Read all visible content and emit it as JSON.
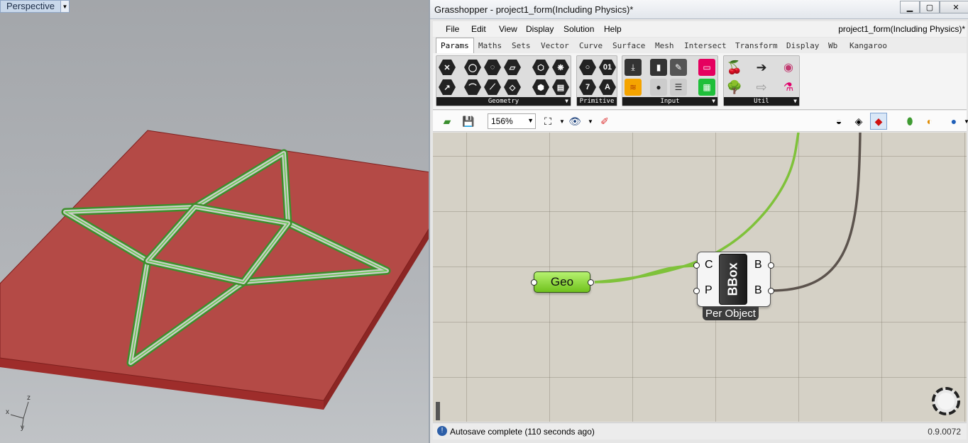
{
  "viewport": {
    "name": "Perspective",
    "axes": {
      "x": "x",
      "y": "y",
      "z": "z"
    }
  },
  "grasshopper": {
    "window_title": "Grasshopper - project1_form(Including Physics)*",
    "document_name": "project1_form(Including Physics)*",
    "menu": [
      "File",
      "Edit",
      "View",
      "Display",
      "Solution",
      "Help"
    ],
    "tabs": [
      "Params",
      "Maths",
      "Sets",
      "Vector",
      "Curve",
      "Surface",
      "Mesh",
      "Intersect",
      "Transform",
      "Display",
      "Wb",
      "Kangaroo"
    ],
    "active_tab": "Params",
    "groups": [
      "Geometry",
      "Primitive",
      "Input",
      "Util"
    ],
    "zoom": "156%",
    "nodes": {
      "geo": {
        "label": "Geo"
      },
      "bbox": {
        "label": "BBox",
        "inputs": [
          "C",
          "P"
        ],
        "outputs": [
          "B",
          "B"
        ],
        "caption": "Per Object"
      }
    },
    "status": {
      "message": "Autosave complete (110 seconds ago)",
      "version": "0.9.0072"
    },
    "colors": {
      "geo_wire": "#7fc23a",
      "bbox_wire": "#5c534d",
      "canvas": "#d5d1c6"
    }
  }
}
